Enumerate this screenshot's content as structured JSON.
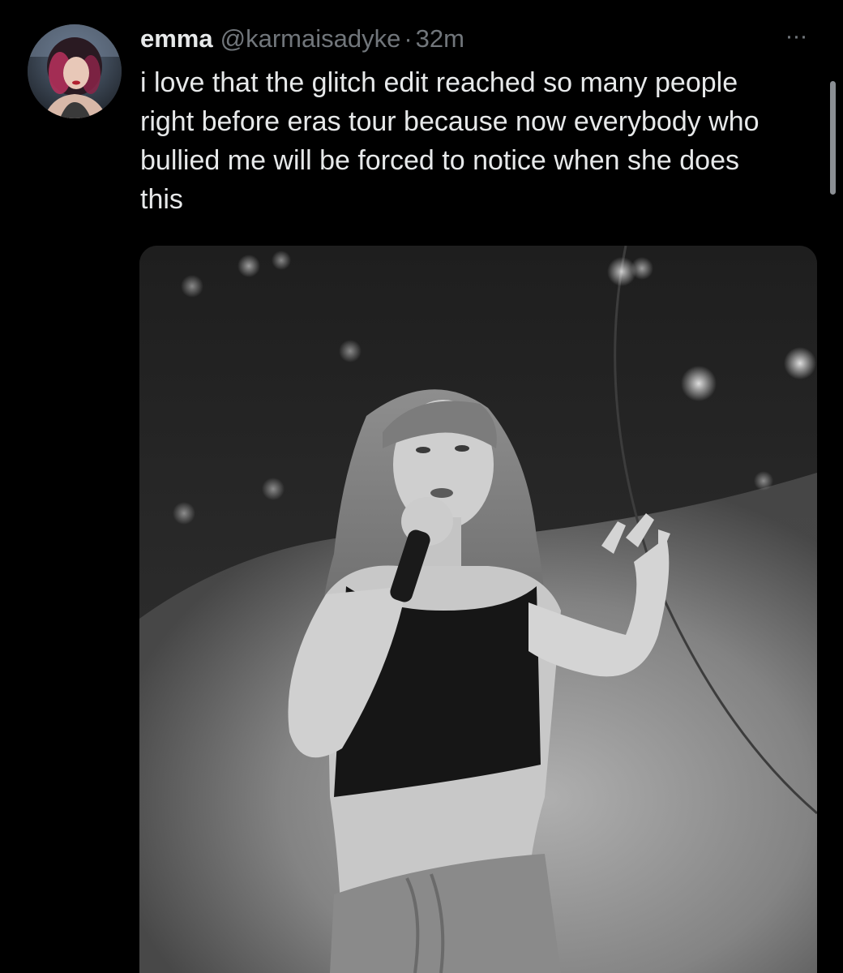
{
  "tweet": {
    "display_name": "emma",
    "handle": "@karmaisadyke",
    "separator": "·",
    "time": "32m",
    "text": "i love that the glitch edit reached so many people right before eras tour because now everybody who bullied me will be forced to notice when she does this",
    "more_label": "···",
    "avatar_icon": "profile-avatar",
    "media_icon": "concert-photo"
  },
  "colors": {
    "background": "#000000",
    "primary_text": "#e7e9ea",
    "secondary_text": "#71767b"
  }
}
